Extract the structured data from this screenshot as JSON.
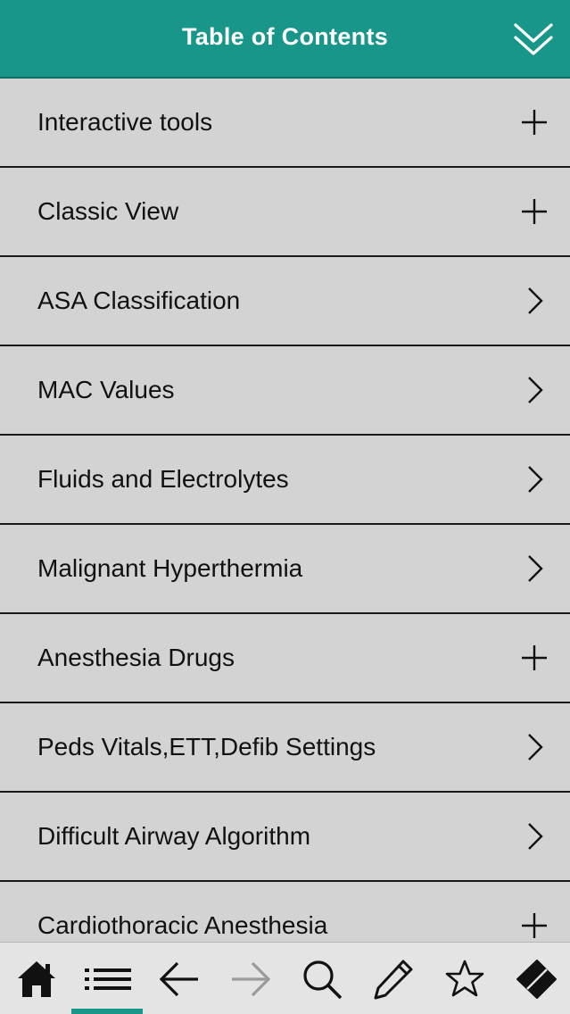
{
  "header": {
    "title": "Table of Contents",
    "collapse_icon": "double-chevron-down-icon",
    "background_color": "#18968a"
  },
  "toc": {
    "items": [
      {
        "label": "Interactive tools",
        "icon": "plus-icon"
      },
      {
        "label": "Classic View",
        "icon": "plus-icon"
      },
      {
        "label": "ASA Classification",
        "icon": "chevron-right-icon"
      },
      {
        "label": "MAC Values",
        "icon": "chevron-right-icon"
      },
      {
        "label": "Fluids and Electrolytes",
        "icon": "chevron-right-icon"
      },
      {
        "label": "Malignant Hyperthermia",
        "icon": "chevron-right-icon"
      },
      {
        "label": "Anesthesia Drugs",
        "icon": "plus-icon"
      },
      {
        "label": "Peds Vitals,ETT,Defib Settings",
        "icon": "chevron-right-icon"
      },
      {
        "label": "Difficult Airway Algorithm",
        "icon": "chevron-right-icon"
      },
      {
        "label": "Cardiothoracic Anesthesia",
        "icon": "plus-icon"
      }
    ]
  },
  "tabbar": {
    "active_tab": "contents",
    "tabs": [
      {
        "name": "home",
        "icon": "home-icon"
      },
      {
        "name": "contents",
        "icon": "list-icon"
      },
      {
        "name": "back",
        "icon": "arrow-left-icon"
      },
      {
        "name": "forward",
        "icon": "arrow-right-icon",
        "disabled": true
      },
      {
        "name": "search",
        "icon": "search-icon"
      },
      {
        "name": "notes",
        "icon": "pencil-icon"
      },
      {
        "name": "favorites",
        "icon": "star-icon"
      },
      {
        "name": "eraser",
        "icon": "eraser-icon"
      }
    ],
    "accent_color": "#18968a"
  }
}
